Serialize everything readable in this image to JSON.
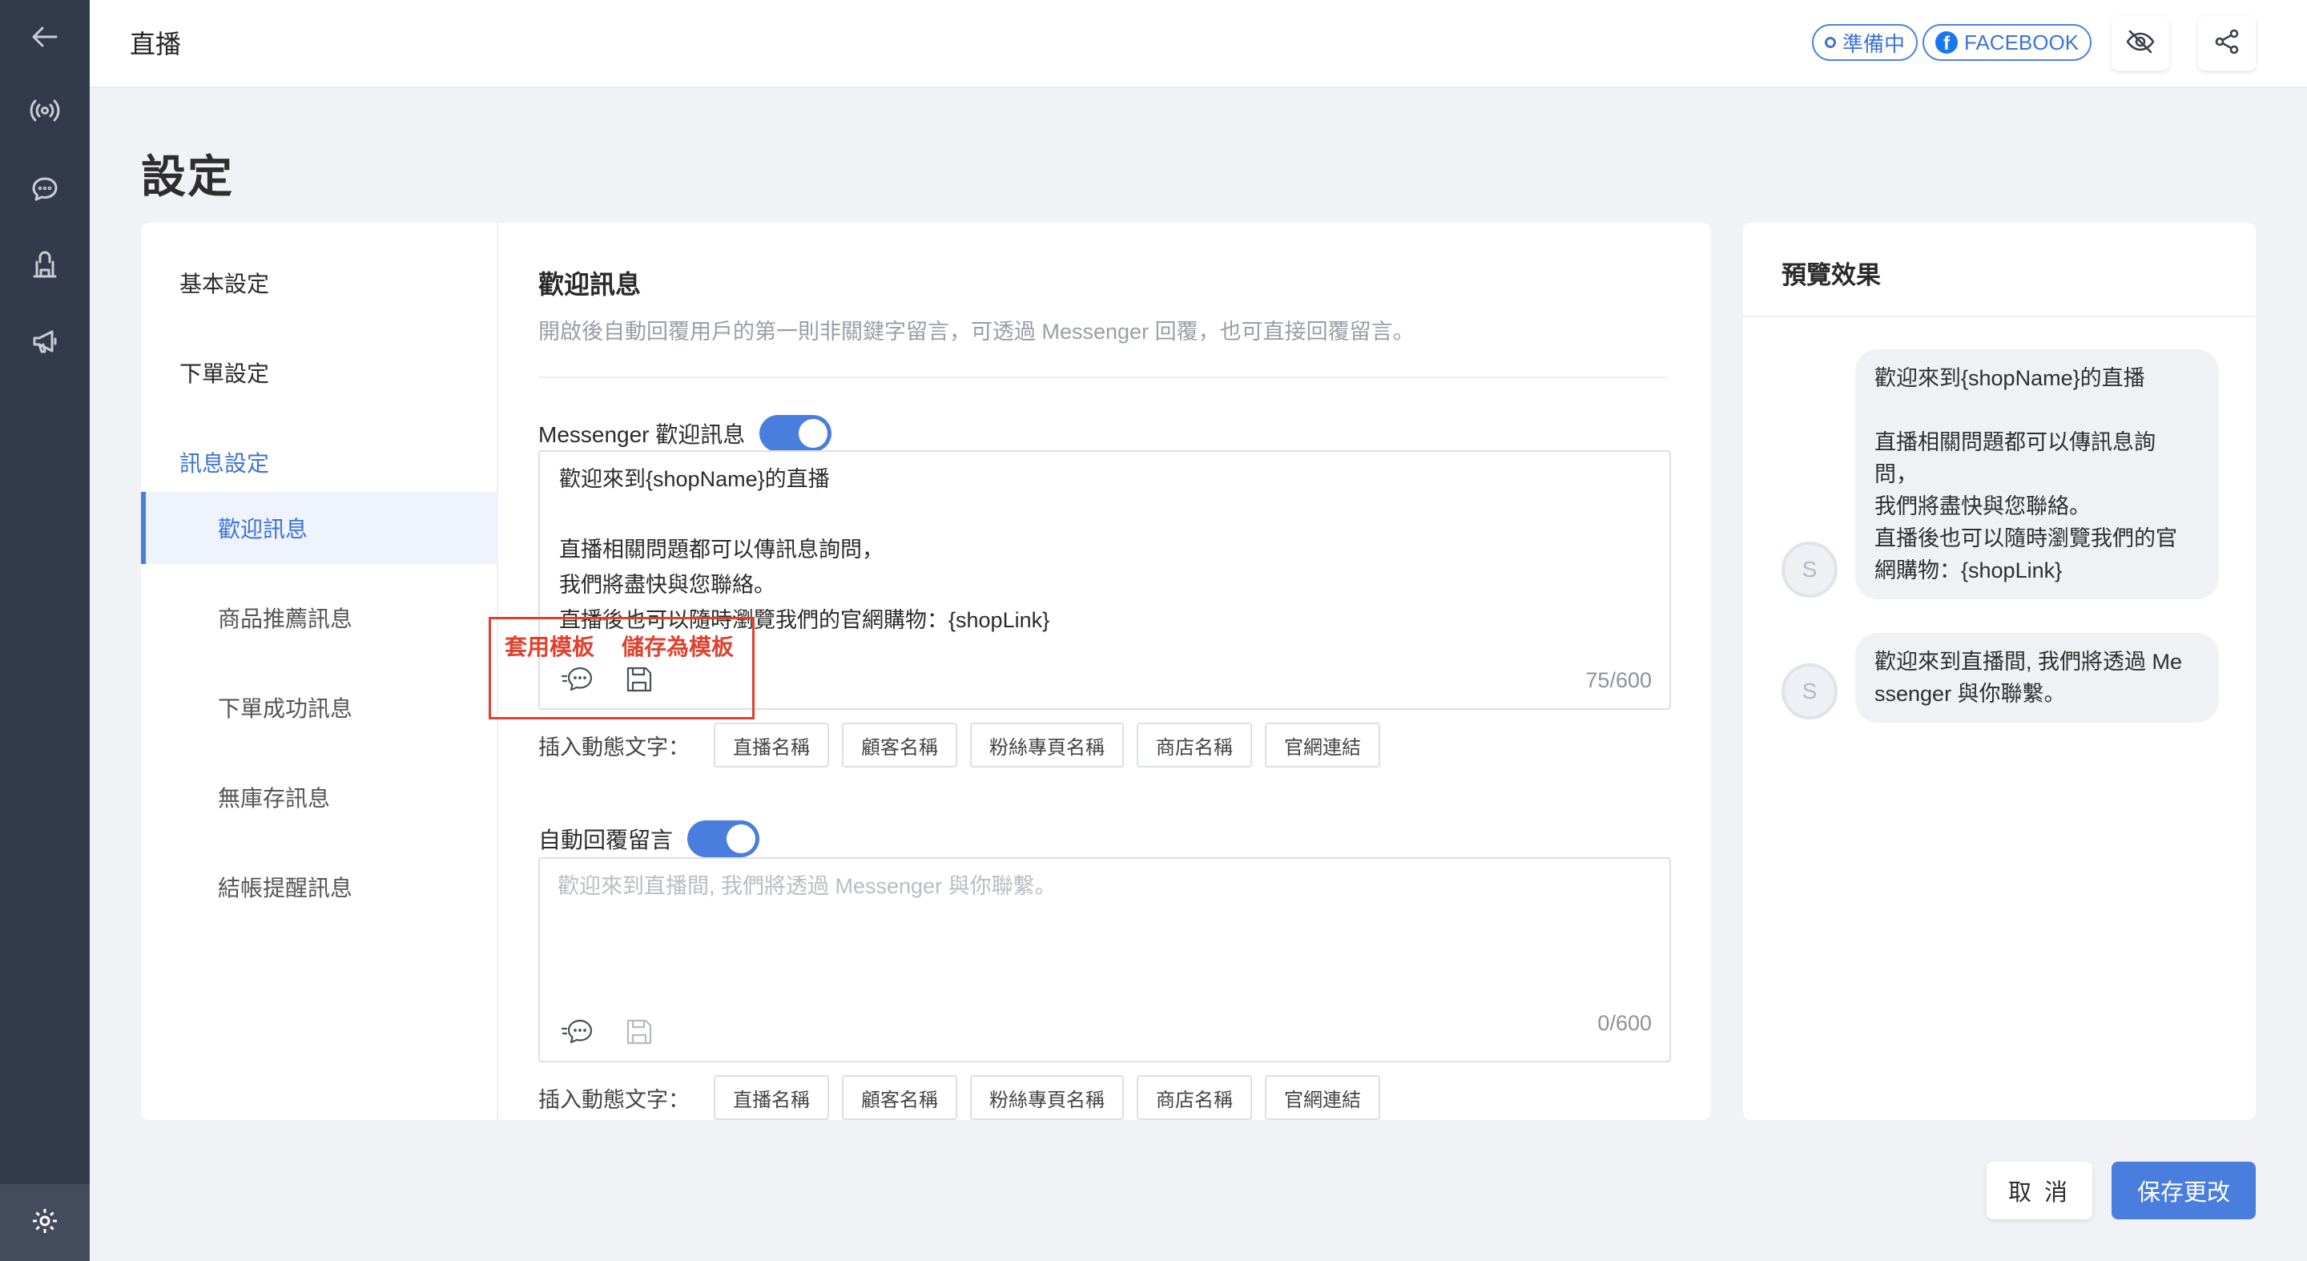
{
  "header": {
    "title": "直播",
    "status_label": "準備中",
    "platform_label": "FACEBOOK"
  },
  "page": {
    "title": "設定"
  },
  "subnav": {
    "basic": "基本設定",
    "order": "下單設定",
    "message": "訊息設定",
    "items": [
      {
        "label": "歡迎訊息"
      },
      {
        "label": "商品推薦訊息"
      },
      {
        "label": "下單成功訊息"
      },
      {
        "label": "無庫存訊息"
      },
      {
        "label": "結帳提醒訊息"
      }
    ]
  },
  "welcome": {
    "title": "歡迎訊息",
    "description": "開啟後自動回覆用戶的第一則非關鍵字留言，可透過 Messenger 回覆，也可直接回覆留言。",
    "messenger": {
      "toggle_label": "Messenger 歡迎訊息",
      "enabled": true,
      "lines": [
        "歡迎來到{shopName}的直播",
        "",
        "直播相關問題都可以傳訊息詢問，",
        "我們將盡快與您聯絡。",
        "直播後也可以隨時瀏覽我們的官網購物：{shopLink}"
      ],
      "counter": "75/600"
    },
    "annotation": {
      "apply_template": "套用模板",
      "save_template": "儲存為模板"
    },
    "insert_label": "插入動態文字：",
    "chips": [
      "直播名稱",
      "顧客名稱",
      "粉絲專頁名稱",
      "商店名稱",
      "官網連結"
    ],
    "auto_reply": {
      "toggle_label": "自動回覆留言",
      "enabled": true,
      "placeholder": "歡迎來到直播間, 我們將透過 Messenger 與你聯繫。",
      "counter": "0/600"
    }
  },
  "preview": {
    "title": "預覽效果",
    "avatar_initial": "S",
    "bubble1_lines": [
      "歡迎來到{shopName}的直播",
      "",
      "直播相關問題都可以傳訊息詢",
      "問，",
      "我們將盡快與您聯絡。",
      "直播後也可以隨時瀏覽我們的官",
      "網購物：{shopLink}"
    ],
    "bubble2_lines": [
      "歡迎來到直播間, 我們將透過 Me",
      "ssenger 與你聯繫。"
    ]
  },
  "footer": {
    "cancel_label": "取 消",
    "save_label": "保存更改"
  },
  "colors": {
    "accent": "#4a7ede",
    "sidebar": "#323a4b",
    "annotation": "#e0412f"
  },
  "icons": {
    "back": "arrow-left-icon",
    "live": "broadcast-icon",
    "chat": "chat-icon",
    "store": "store-icon",
    "promo": "megaphone-icon",
    "settings": "gear-icon",
    "visibility": "eye-off-icon",
    "share": "share-icon"
  }
}
